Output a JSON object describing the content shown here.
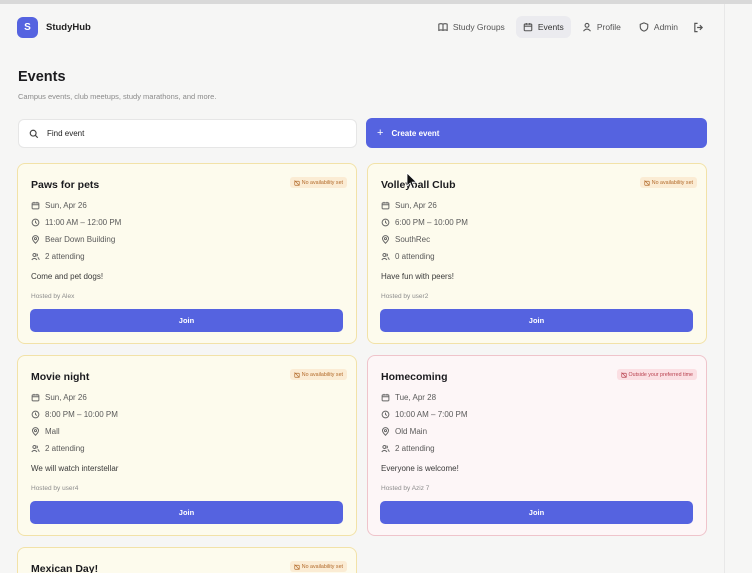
{
  "app": {
    "logo_letter": "S",
    "name": "StudyHub"
  },
  "nav": {
    "items": [
      {
        "label": "Study Groups",
        "icon": "book-icon",
        "active": false
      },
      {
        "label": "Events",
        "icon": "calendar-icon",
        "active": true
      },
      {
        "label": "Profile",
        "icon": "user-icon",
        "active": false
      },
      {
        "label": "Admin",
        "icon": "shield-icon",
        "active": false
      }
    ],
    "logout_icon": "logout-icon"
  },
  "page": {
    "title": "Events",
    "subtitle": "Campus events, club meetups, study marathons, and more."
  },
  "search": {
    "placeholder": "Find event"
  },
  "create_button": {
    "label": "Create event"
  },
  "events": [
    {
      "title": "Paws for pets",
      "badge": "No availability set",
      "date": "Sun, Apr 26",
      "time": "11:00 AM – 12:00 PM",
      "location": "Bear Down Building",
      "attending": "2 attending",
      "description": "Come and pet dogs!",
      "host": "Hosted by Alex",
      "join_label": "Join"
    },
    {
      "title": "Volleyball Club",
      "badge": "No availability set",
      "date": "Sun, Apr 26",
      "time": "6:00 PM – 10:00 PM",
      "location": "SouthRec",
      "attending": "0 attending",
      "description": "Have fun with peers!",
      "host": "Hosted by user2",
      "join_label": "Join"
    },
    {
      "title": "Movie night",
      "badge": "No availability set",
      "date": "Sun, Apr 26",
      "time": "8:00 PM – 10:00 PM",
      "location": "Mall",
      "attending": "2 attending",
      "description": "We will watch interstellar",
      "host": "Hosted by user4",
      "join_label": "Join"
    },
    {
      "title": "Homecoming",
      "badge": "Outside your preferred time",
      "date": "Tue, Apr 28",
      "time": "10:00 AM – 7:00 PM",
      "location": "Old Main",
      "attending": "2 attending",
      "description": "Everyone is welcome!",
      "host": "Hosted by Aziz 7",
      "join_label": "Join"
    },
    {
      "title": "Mexican Day!",
      "badge": "No availability set"
    }
  ],
  "colors": {
    "accent": "#5563e0",
    "card_yellow_bg": "#fdfbed",
    "card_yellow_border": "#f2e2a8",
    "card_pink_bg": "#fdf6f7",
    "card_pink_border": "#efc4cb"
  }
}
